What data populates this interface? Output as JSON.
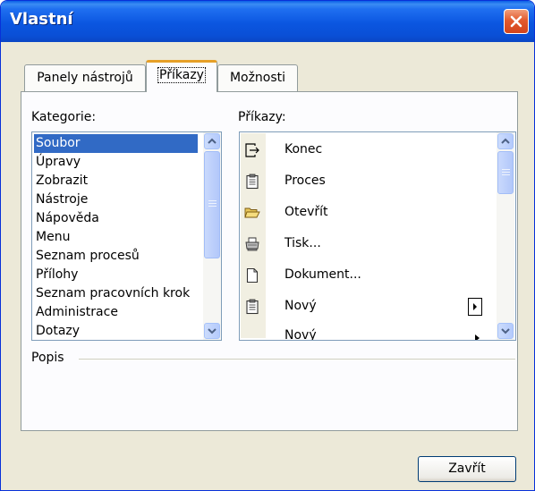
{
  "window": {
    "title": "Vlastní"
  },
  "tabs": [
    {
      "label": "Panely nástrojů",
      "active": false
    },
    {
      "label": "Příkazy",
      "active": true
    },
    {
      "label": "Možnosti",
      "active": false
    }
  ],
  "kategorie": {
    "label": "Kategorie:",
    "items": [
      "Soubor",
      "Úpravy",
      "Zobrazit",
      "Nástroje",
      "Nápověda",
      "Menu",
      "Seznam procesů",
      "Přílohy",
      "Seznam pracovních krok",
      "Administrace",
      "Dotazy"
    ],
    "selected_index": 0
  },
  "prikazy": {
    "label": "Příkazy:",
    "items": [
      {
        "label": "Konec",
        "icon": "exit-icon"
      },
      {
        "label": "Proces",
        "icon": "clipboard-icon"
      },
      {
        "label": "Otevřít",
        "icon": "open-folder-icon"
      },
      {
        "label": "Tisk...",
        "icon": "printer-icon"
      },
      {
        "label": "Dokument...",
        "icon": "document-icon"
      },
      {
        "label": "Nový",
        "icon": "clipboard-icon",
        "submenu": true
      },
      {
        "label": "Nový",
        "icon": "",
        "submenu": true
      }
    ]
  },
  "popis": {
    "label": "Popis"
  },
  "buttons": {
    "close_label": "Zavřít"
  },
  "colors": {
    "titlebar": "#0a56e0",
    "selection": "#316ac5",
    "dialog_bg": "#ece9d8",
    "tab_hot": "#e6a028"
  }
}
